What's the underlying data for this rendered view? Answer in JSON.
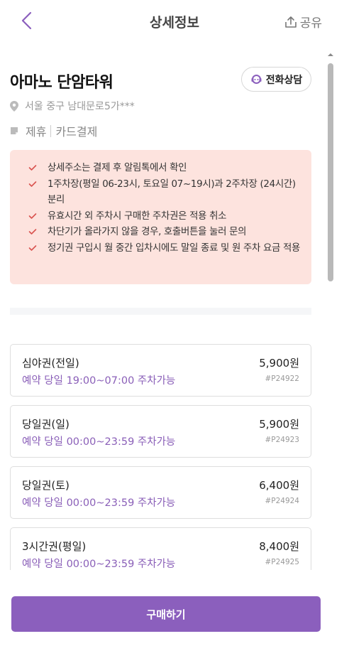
{
  "header": {
    "title": "상세정보",
    "share_label": "공유"
  },
  "place": {
    "name": "아마노 단암타워",
    "call_label": "전화상담",
    "address": "서울 중구 남대문로5가***",
    "tags": [
      "제휴",
      "카드결제"
    ]
  },
  "notices": [
    "상세주소는 결제 후 알림톡에서 확인",
    "1주차장(평일 06-23시, 토요일 07~19시)과 2주차장 (24시간) 분리",
    "유효시간 외 주차시 구매한 주차권은 적용 취소",
    "차단기가 올라가지 않을 경우, 호출버튼을 눌러 문의",
    "정기권 구입시 월 중간 입차시에도 말일 종료 및 원 주차 요금 적용"
  ],
  "tickets": [
    {
      "name": "심야권(전일)",
      "price": "5,900원",
      "time": "예약 당일 19:00~07:00 주차가능",
      "code": "#P24922"
    },
    {
      "name": "당일권(일)",
      "price": "5,900원",
      "time": "예약 당일 00:00~23:59 주차가능",
      "code": "#P24923"
    },
    {
      "name": "당일권(토)",
      "price": "6,400원",
      "time": "예약 당일 00:00~23:59 주차가능",
      "code": "#P24924"
    },
    {
      "name": "3시간권(평일)",
      "price": "8,400원",
      "time": "예약 당일 00:00~23:59 주차가능",
      "code": "#P24925"
    }
  ],
  "buy_label": "구매하기",
  "colors": {
    "accent": "#8b5fbd",
    "notice_bg": "#fde3de",
    "check": "#d9534f"
  }
}
